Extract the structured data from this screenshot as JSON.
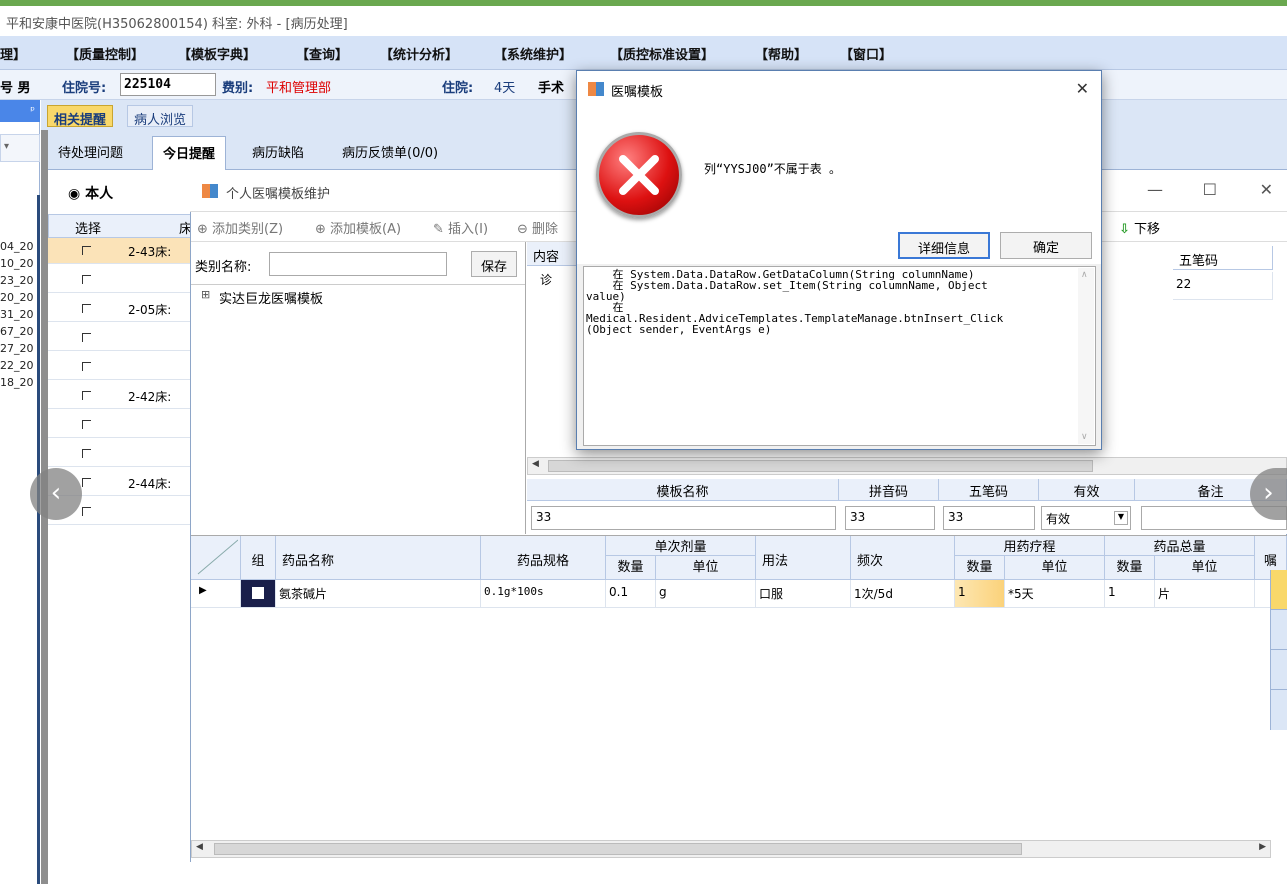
{
  "app": {
    "title": "平和安康中医院(H35062800154)  科室: 外科 - [病历处理]"
  },
  "menu": [
    "理】",
    "【质量控制】",
    "【模板字典】",
    "【查询】",
    "【统计分析】",
    "【系统维护】",
    "【质控标准设置】",
    "【帮助】",
    "【窗口】"
  ],
  "patient": {
    "gender": "号 男",
    "zyh_label": "住院号:",
    "zyh_value": "225104",
    "fb_label": "费别:",
    "fb_value": "平和管理部",
    "zy_label": "住院:",
    "zy_value": "4天",
    "ss_label": "手术"
  },
  "left_dates": [
    "04_20",
    "10_20",
    "23_20",
    "20_20",
    "31_20",
    "67_20",
    "27_20",
    "22_20",
    "18_20"
  ],
  "tabs1": [
    "相关提醒",
    "病人浏览"
  ],
  "tabs2": [
    "待处理问题",
    "今日提醒",
    "病历缺陷",
    "病历反馈单(0/0)"
  ],
  "radio": "◉ 本人",
  "grid1": {
    "col_select": "选择",
    "col_bed": "床",
    "beds": [
      "2-43床:",
      "",
      "2-05床:",
      "",
      "",
      "2-42床:",
      "",
      "",
      "2-44床:",
      ""
    ]
  },
  "win": {
    "title": "个人医嘱模板维护",
    "min": "—",
    "max": "☐",
    "close": "✕",
    "toolbar": [
      "添加类别(Z)",
      "添加模板(A)",
      "插入(I)",
      "删除"
    ],
    "down": "下移",
    "category_label": "类别名称:",
    "save": "保存",
    "tree": "实达巨龙医嘱模板",
    "rgrid_head": {
      "content": "内容",
      "wubi": "五笔码"
    },
    "rgrid_row": {
      "content": "诊",
      "wubi": "22"
    },
    "tpl_head": {
      "name": "模板名称",
      "py": "拼音码",
      "wb": "五笔码",
      "valid": "有效",
      "note": "备注"
    },
    "tpl_row": {
      "name": "33",
      "py": "33",
      "wb": "33",
      "valid": "有效"
    },
    "bottom_head": {
      "group": "组",
      "drug": "药品名称",
      "spec": "药品规格",
      "dose": "单次剂量",
      "dose_qty": "数量",
      "dose_unit": "单位",
      "usage": "用法",
      "freq": "频次",
      "course": "用药疗程",
      "course_qty": "数量",
      "course_unit": "单位",
      "total": "药品总量",
      "total_qty": "数量",
      "total_unit": "单位",
      "extra": "嘱"
    },
    "bottom_row": {
      "drug": "氨茶碱片",
      "spec": "0.1g*100s",
      "dose_qty": "0.1",
      "dose_unit": "g",
      "usage": "口服",
      "freq": "1次/5d",
      "course_qty": "1",
      "course_unit": "*5天",
      "total_qty": "1",
      "total_unit": "片"
    }
  },
  "dialog": {
    "title": "医嘱模板",
    "close": "✕",
    "message": "列“YYSJ00”不属于表 。",
    "details": "详细信息",
    "ok": "确定",
    "trace": "    在 System.Data.DataRow.GetDataColumn(String columnName)\n    在 System.Data.DataRow.set_Item(String columnName, Object\nvalue)\n    在\nMedical.Resident.AdviceTemplates.TemplateManage.btnInsert_Click\n(Object sender, EventArgs e)"
  },
  "colors": {
    "accent": "#6aa84f",
    "menu_bg": "#d6e3f7",
    "error": "#d11"
  }
}
